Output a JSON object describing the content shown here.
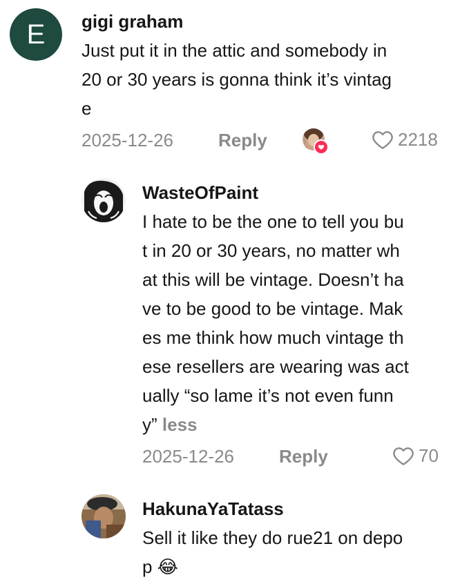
{
  "comments": [
    {
      "avatar_letter": "E",
      "avatar_color": "#1e4a40",
      "username": "gigi graham",
      "text_lines": [
        "Just put it in the attic and somebody in",
        "20 or 30 years is gonna think it’s vintag",
        "e"
      ],
      "date": "2025-12-26",
      "reply_label": "Reply",
      "likes": "2218",
      "creator_liked": true
    }
  ],
  "replies": [
    {
      "username": "WasteOfPaint",
      "text_lines": [
        "I hate to be the one to tell you bu",
        "t in 20 or 30 years, no matter wh",
        "at this will be vintage. Doesn’t ha",
        "ve to be good to be vintage. Mak",
        "es me think how much vintage th",
        "ese resellers are wearing was act",
        "ually “so lame it’s not even funn",
        "y”"
      ],
      "less_label": "less",
      "date": "2025-12-26",
      "reply_label": "Reply",
      "likes": "70"
    },
    {
      "username": "HakunaYaTatass",
      "text_lines": [
        "Sell it like they do rue21 on depo",
        "p 😂"
      ]
    }
  ],
  "colors": {
    "muted": "#8a8a8a",
    "text": "#161616",
    "badge": "#fe2c55"
  },
  "icons": {
    "like": "heart-outline-icon",
    "creator_like_badge": "heart-icon"
  }
}
